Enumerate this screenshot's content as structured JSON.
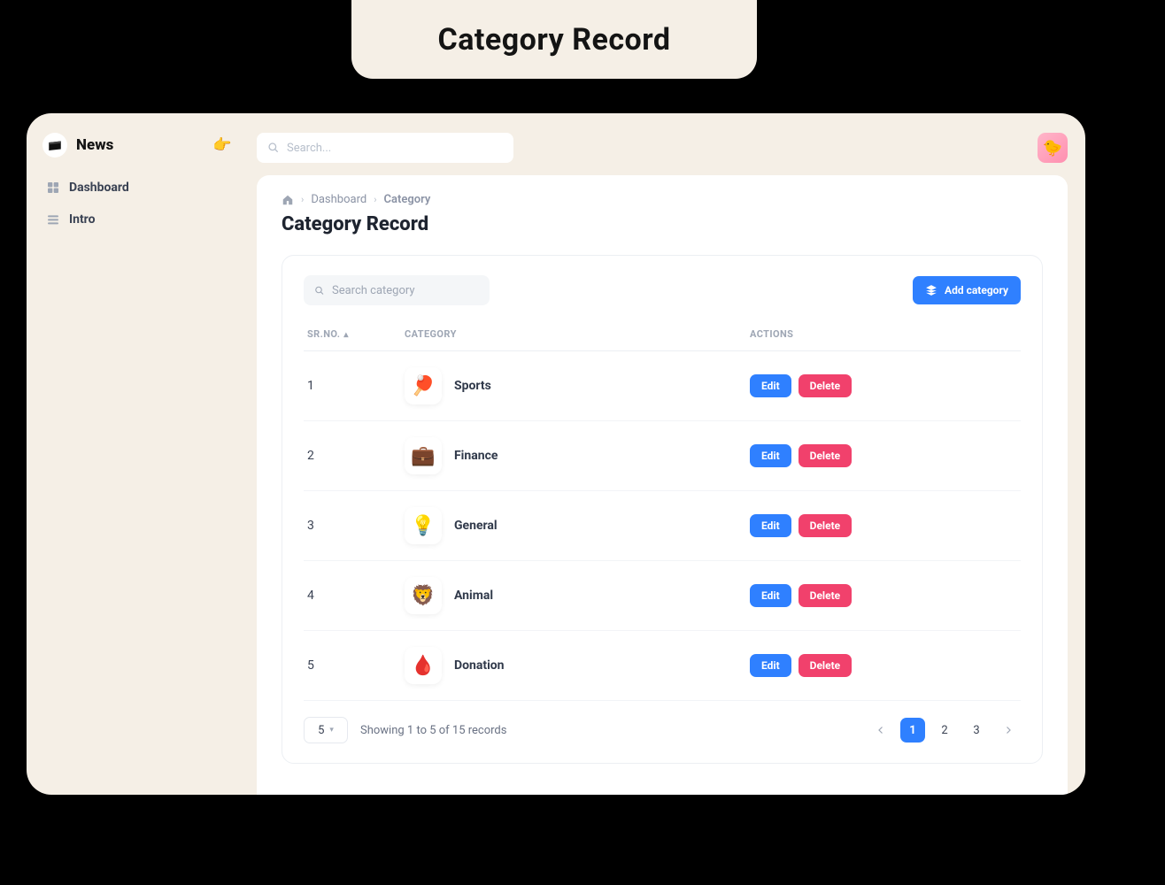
{
  "title_card": "Category Record",
  "logo": "News",
  "search": {
    "placeholder": "Search..."
  },
  "sidebar": {
    "items": [
      {
        "label": "Dashboard"
      },
      {
        "label": "Intro"
      }
    ]
  },
  "breadcrumb": {
    "item1": "Dashboard",
    "item2": "Category"
  },
  "page_title": "Category Record",
  "card": {
    "search_placeholder": "Search category",
    "add_label": "Add category",
    "headers": {
      "srno": "SR.NO.",
      "category": "CATEGORY",
      "actions": "ACTIONS"
    },
    "rows": [
      {
        "n": "1",
        "name": "Sports",
        "emoji": "🏓"
      },
      {
        "n": "2",
        "name": "Finance",
        "emoji": "💼"
      },
      {
        "n": "3",
        "name": "General",
        "emoji": "💡"
      },
      {
        "n": "4",
        "name": "Animal",
        "emoji": "🦁"
      },
      {
        "n": "5",
        "name": "Donation",
        "emoji": "🩸"
      }
    ],
    "edit_label": "Edit",
    "delete_label": "Delete"
  },
  "pagination": {
    "page_size": "5",
    "showing": "Showing 1 to 5 of 15 records",
    "pages": [
      "1",
      "2",
      "3"
    ],
    "active": "1"
  }
}
